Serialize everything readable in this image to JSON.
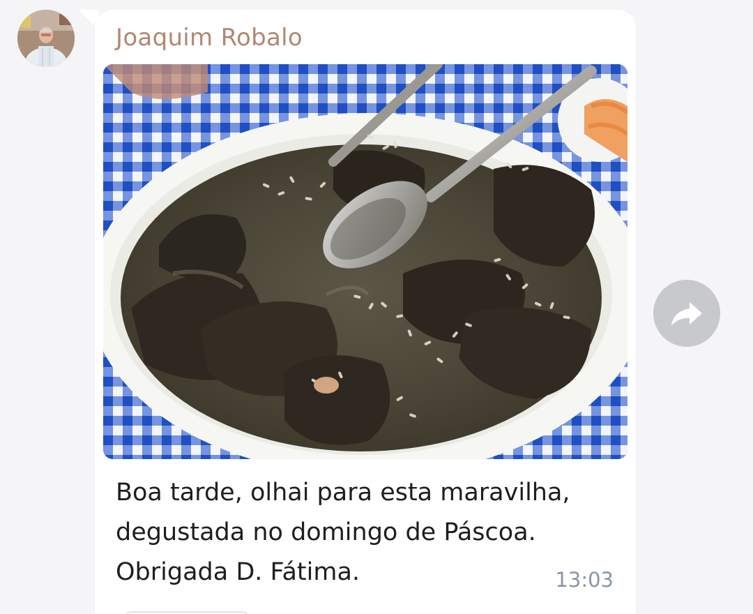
{
  "message": {
    "sender_name": "Joaquim Robalo",
    "photo_description_icon": "food-photo",
    "text": "Boa tarde, olhai para esta maravilha,\ndegustada no domingo de Páscoa.\nObrigada D. Fátima.",
    "time": "13:03"
  },
  "actions": {
    "forward_icon": "share-arrow-icon"
  },
  "colors": {
    "background": "#f5f5f7",
    "bubble": "#ffffff",
    "sender_name": "#b08872",
    "message_text": "#1e1e1e",
    "timestamp": "#8a96a3",
    "forward_button": "#c8c9cc"
  }
}
